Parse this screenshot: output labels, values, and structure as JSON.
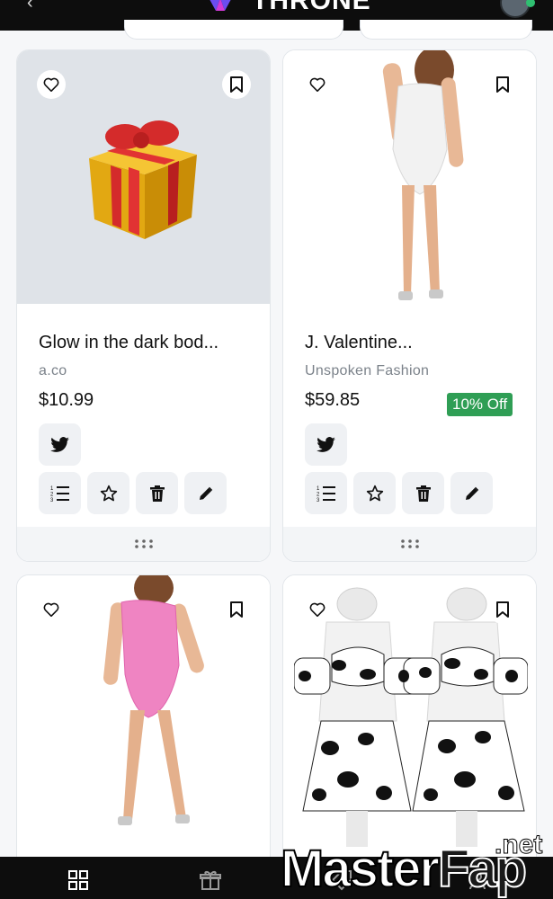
{
  "header": {
    "brand": "THRONE",
    "back_glyph": "‹",
    "icons": [
      "back-icon",
      "throne-logo-icon",
      "avatar"
    ]
  },
  "cards": [
    {
      "title": "Glow in the dark bod...",
      "site": "a.co",
      "price": "$10.99",
      "discount": "",
      "image": "gift-box-icon",
      "image_bg": "#dfe3e8"
    },
    {
      "title": "J. Valentine...",
      "site": "Unspoken Fashion",
      "price": "$59.85",
      "discount": "10% Off",
      "image": "white-bodysuit-photo",
      "image_bg": "#ffffff"
    },
    {
      "title": "",
      "site": "",
      "price": "",
      "discount": "",
      "image": "pink-bodysuit-photo",
      "image_bg": "#ffffff"
    },
    {
      "title": "",
      "site": "",
      "price": "",
      "discount": "",
      "image": "cow-print-outfits-photo",
      "image_bg": "#ffffff"
    }
  ],
  "card_actions": [
    "twitter-icon",
    "list-icon",
    "star-icon",
    "trash-icon",
    "pencil-icon"
  ],
  "bottom_nav": [
    "grid-icon",
    "gift-icon",
    "tag-icon",
    "users-icon"
  ],
  "watermark": {
    "text_master": "Master",
    "text_fap": "Fap",
    "text_net": ".net"
  },
  "colors": {
    "discount_green": "#2f9e55",
    "topbar": "#0d0d0d",
    "image_gray": "#dfe3e8"
  }
}
